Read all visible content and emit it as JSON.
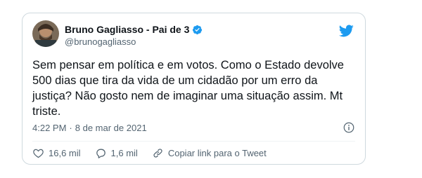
{
  "author": {
    "display_name": "Bruno Gagliasso - Pai de 3",
    "handle": "@brunogagliasso",
    "verified_icon": "verified-badge-icon",
    "avatar": "avatar"
  },
  "brand": {
    "icon": "twitter-bird-icon",
    "color": "#1d9bf0"
  },
  "tweet": {
    "lines": [
      "Sem pensar em política e em votos. Como o Estado devolve",
      "500 dias que tira da vida de um cidadão por um erro da",
      "justiça? Não gosto nem de imaginar uma situação assim. Mt",
      "triste."
    ],
    "time": "4:22 PM",
    "separator": "·",
    "date": "8 de mar de 2021",
    "info_icon": "info-icon"
  },
  "actions": {
    "likes": "16,6 mil",
    "replies": "1,6 mil",
    "copy_link": "Copiar link para o Tweet"
  }
}
